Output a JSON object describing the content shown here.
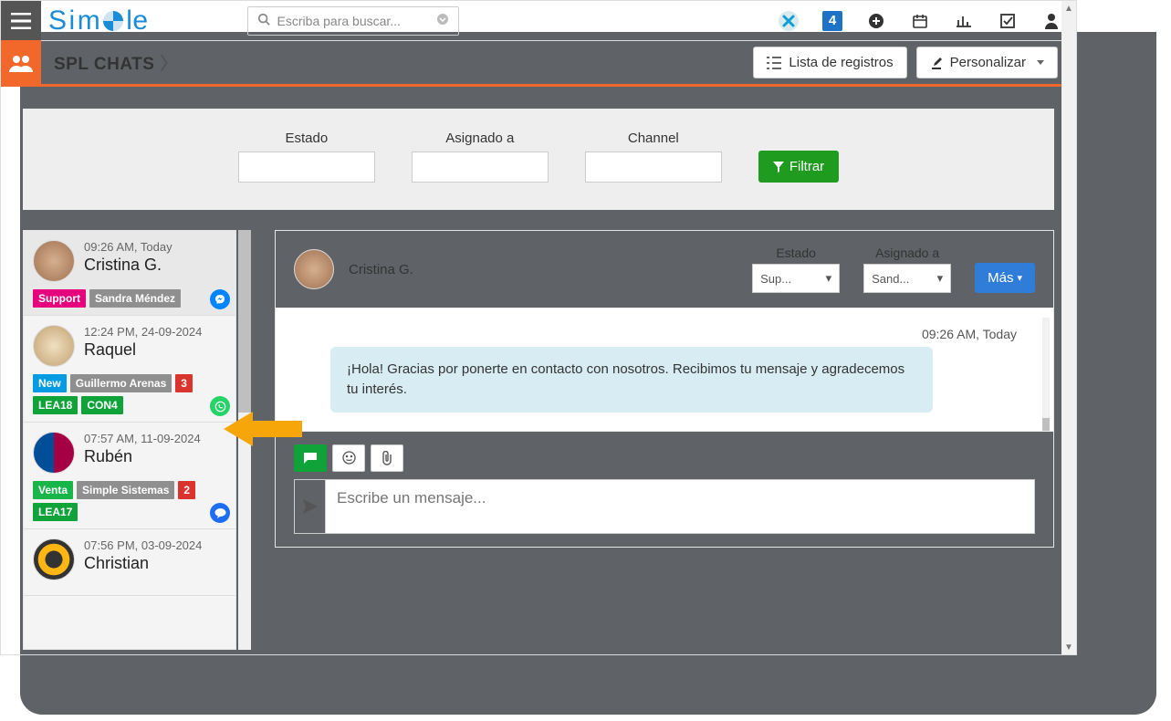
{
  "topbar": {
    "logo": "Simple",
    "search_placeholder": "Escriba para buscar..."
  },
  "module": {
    "title": "SPL CHATS",
    "list_btn": "Lista de registros",
    "customize_btn": "Personalizar"
  },
  "filters": {
    "estado": "Estado",
    "asignado": "Asignado a",
    "channel": "Channel",
    "filtrar": "Filtrar"
  },
  "chats": [
    {
      "time": "09:26 AM, Today",
      "name": "Cristina G.",
      "tags": [
        {
          "text": "Support",
          "cls": "pink"
        },
        {
          "text": "Sandra Méndez",
          "cls": "grey"
        }
      ],
      "channel": "messenger",
      "active": true
    },
    {
      "time": "12:24 PM, 24-09-2024",
      "name": "Raquel",
      "tags": [
        {
          "text": "New",
          "cls": "blue"
        },
        {
          "text": "Guillermo Arenas",
          "cls": "grey"
        },
        {
          "text": "3",
          "cls": "red"
        },
        {
          "text": "LEA18",
          "cls": "green"
        },
        {
          "text": "CON4",
          "cls": "green"
        }
      ],
      "channel": "whatsapp"
    },
    {
      "time": "07:57 AM, 11-09-2024",
      "name": "Rubén",
      "tags": [
        {
          "text": "Venta",
          "cls": "greenlt"
        },
        {
          "text": "Simple Sistemas",
          "cls": "grey"
        },
        {
          "text": "2",
          "cls": "red"
        },
        {
          "text": "LEA17",
          "cls": "green"
        }
      ],
      "channel": "chat"
    },
    {
      "time": "07:56 PM, 03-09-2024",
      "name": "Christian",
      "tags": [],
      "channel": ""
    }
  ],
  "conv": {
    "name": "Cristina G.",
    "estado_label": "Estado",
    "asignado_label": "Asignado a",
    "estado_val": "Sup...",
    "asignado_val": "Sand...",
    "more": "Más",
    "msg_time": "09:26 AM, Today",
    "msg_text": "¡Hola! Gracias por ponerte en contacto con nosotros. Recibimos tu mensaje y agradecemos tu interés.",
    "compose_placeholder": "Escribe un mensaje..."
  }
}
